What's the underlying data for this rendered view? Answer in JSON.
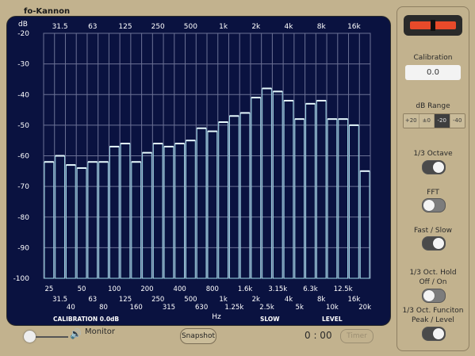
{
  "app": {
    "title": "fo-Kannon"
  },
  "chart_data": {
    "type": "bar",
    "ylabel": "dB",
    "xlabel": "Hz",
    "ylim": [
      -100,
      -20
    ],
    "yticks": [
      -20,
      -30,
      -40,
      -50,
      -60,
      -70,
      -80,
      -90,
      -100
    ],
    "top_labels": [
      "31.5",
      "63",
      "125",
      "250",
      "500",
      "1k",
      "2k",
      "4k",
      "8k",
      "16k"
    ],
    "categories": [
      "25",
      "31.5",
      "40",
      "50",
      "63",
      "80",
      "100",
      "125",
      "160",
      "200",
      "250",
      "315",
      "400",
      "500",
      "630",
      "800",
      "1k",
      "1.25k",
      "1.6k",
      "2k",
      "2.5k",
      "3.15k",
      "4k",
      "5k",
      "6.3k",
      "8k",
      "10k",
      "12.5k",
      "16k",
      "20k"
    ],
    "values": [
      -62,
      -60,
      -63,
      -64,
      -62,
      -62,
      -57,
      -56,
      -62,
      -59,
      -56,
      -57,
      -56,
      -55,
      -51,
      -52,
      -49,
      -47,
      -46,
      -41,
      -38,
      -39,
      -42,
      -48,
      -43,
      -42,
      -48,
      -48,
      -50,
      -65
    ],
    "grid": true,
    "status": {
      "calibration": "CALIBRATION 0.0dB",
      "speed": "SLOW",
      "mode": "LEVEL"
    },
    "colors": {
      "background": "#0a1240",
      "bar": "#9fd9e8",
      "grid": "#6c7296",
      "text": "#ffffff"
    }
  },
  "sidebar": {
    "calibration_label": "Calibration",
    "calibration_value": "0.0",
    "db_range_label": "dB Range",
    "db_range_options": [
      "+20",
      "±0",
      "-20",
      "-40"
    ],
    "db_range_selected": "-20",
    "octave_label": "1/3 Octave",
    "octave_on": true,
    "fft_label": "FFT",
    "fft_on": false,
    "fastslow_label": "Fast / Slow",
    "fastslow_on": true,
    "hold_label1": "1/3 Oct. Hold",
    "hold_label2": "Off / On",
    "hold_on": false,
    "func_label1": "1/3 Oct. Funciton",
    "func_label2": "Peak / Level",
    "func_on": true
  },
  "bottom": {
    "monitor_label": "Monitor",
    "snapshot_label": "Snapshot",
    "time": "0 : 00",
    "timer_label": "Timer"
  }
}
